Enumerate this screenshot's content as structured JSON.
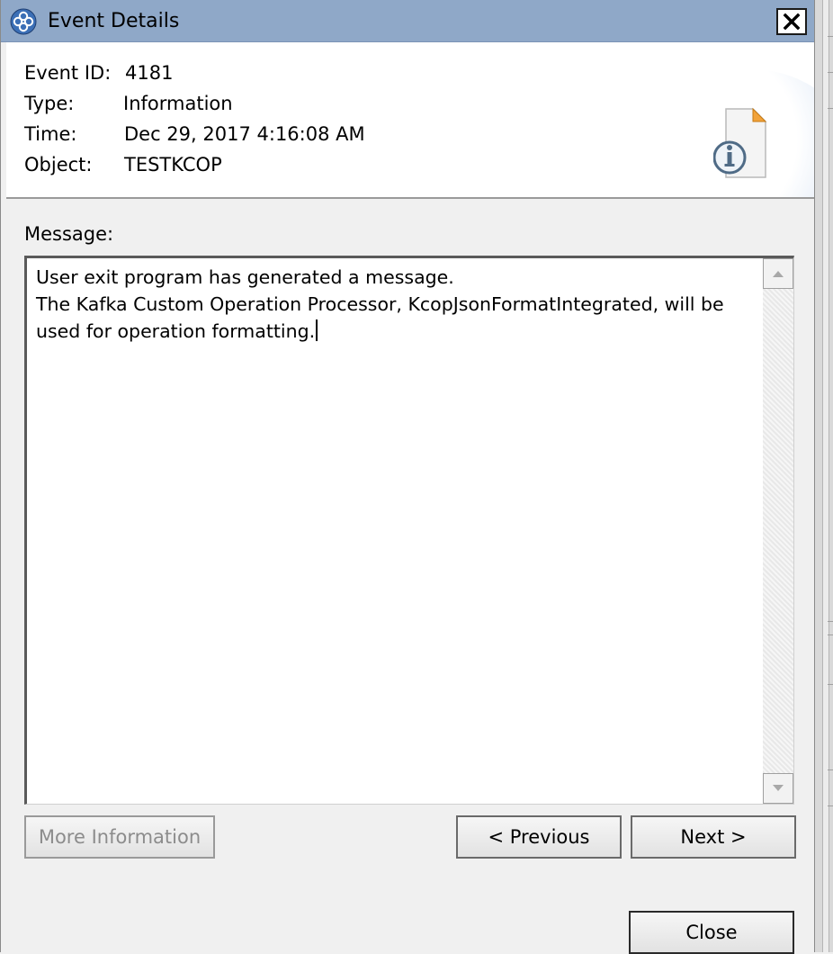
{
  "window": {
    "title": "Event Details",
    "close_label": "✕"
  },
  "header": {
    "event_id_label": "Event ID:",
    "event_id_value": "4181",
    "type_label": "Type:",
    "type_value": "Information",
    "time_label": "Time:",
    "time_value": "Dec 29, 2017 4:16:08 AM",
    "object_label": "Object:",
    "object_value": "TESTKCOP",
    "icon": "information-document-icon"
  },
  "message": {
    "label": "Message:",
    "text": "User exit program has generated a message.\nThe Kafka Custom Operation Processor, KcopJsonFormatIntegrated, will be\nused for operation formatting."
  },
  "buttons": {
    "more_information": "More Information",
    "previous": "< Previous",
    "next": "Next >",
    "close": "Close"
  },
  "colors": {
    "titlebar": "#8fa8c8",
    "background": "#f0f0f0"
  }
}
